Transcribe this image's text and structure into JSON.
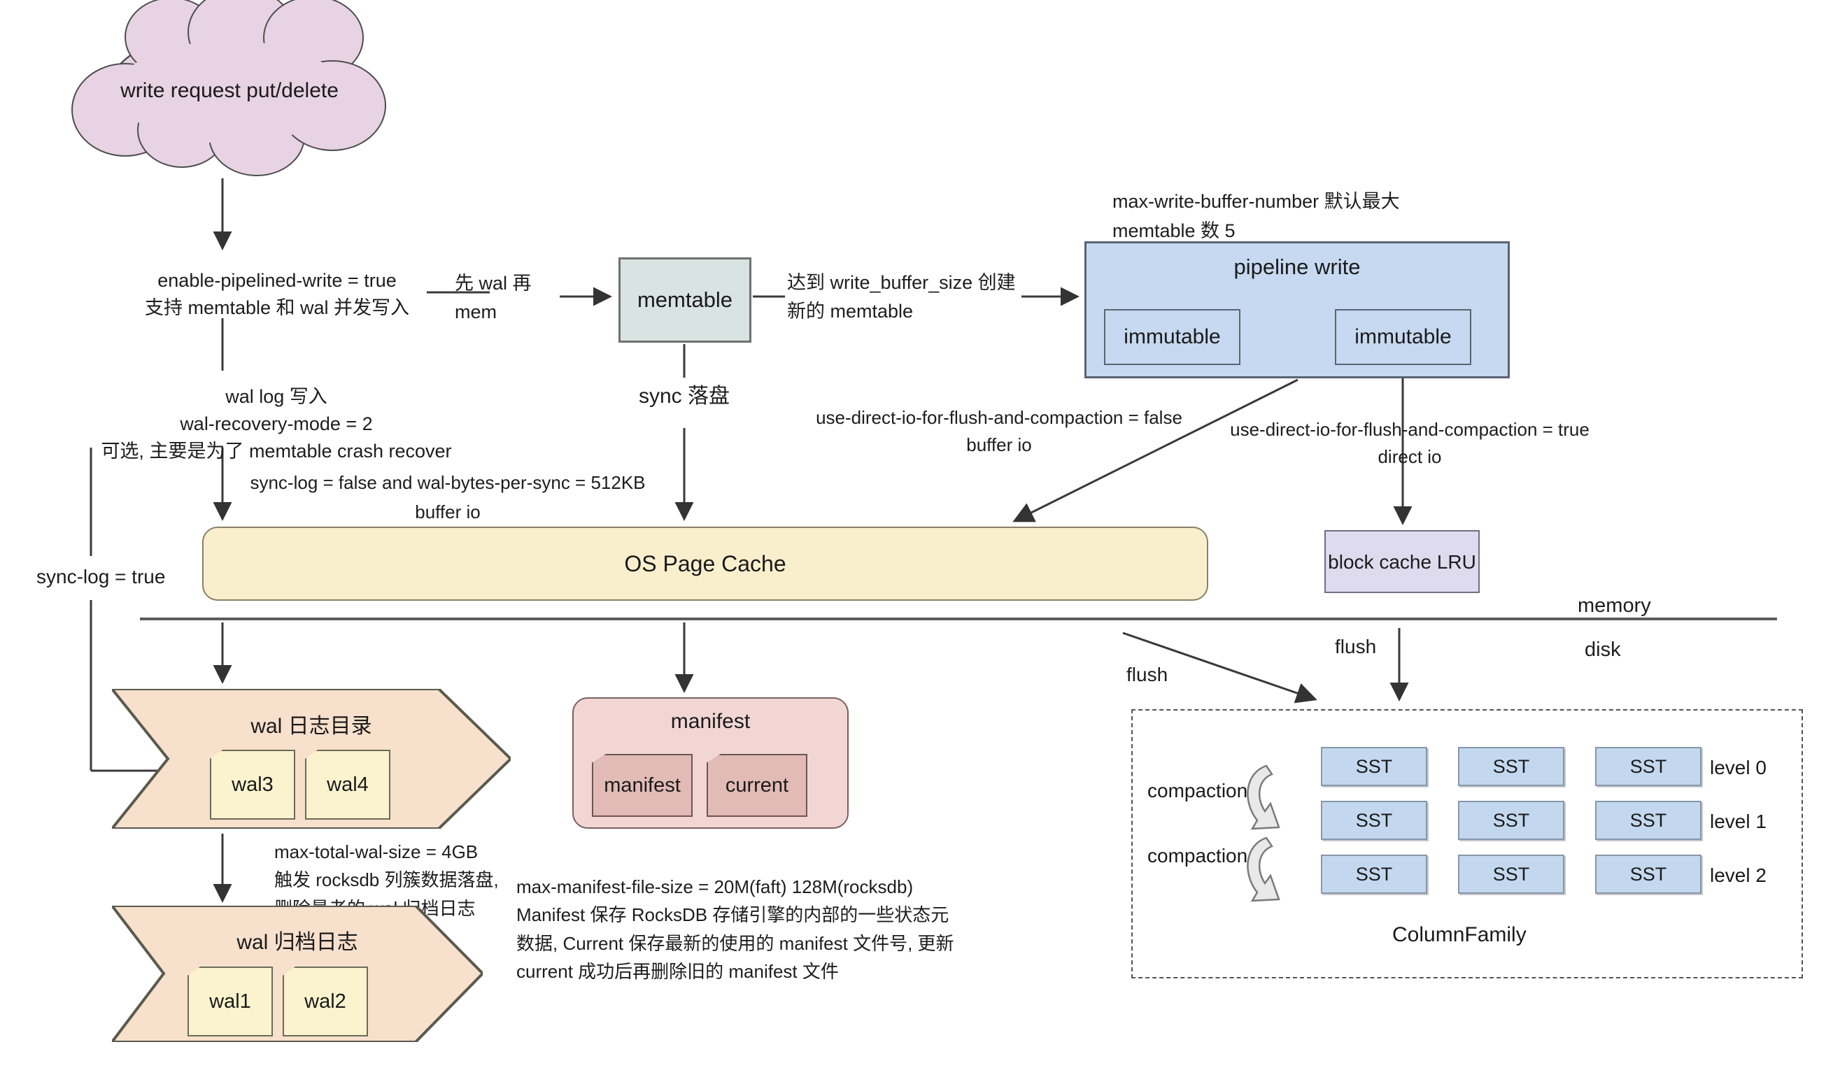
{
  "diagram": {
    "title_nodes": {
      "cloud": "write request\nput/delete",
      "memtable": "memtable",
      "pipeline_write": "pipeline write",
      "immutable_1": "immutable",
      "immutable_2": "immutable",
      "os_page_cache": "OS Page Cache",
      "block_cache": "block cache\nLRU",
      "wal_dir_title": "wal 日志目录",
      "wal_archive_title": "wal 归档日志",
      "manifest_title": "manifest",
      "column_family": "ColumnFamily"
    },
    "wal_dir_files": [
      "wal3",
      "wal4"
    ],
    "wal_archive_files": [
      "wal1",
      "wal2"
    ],
    "manifest_files": [
      "manifest",
      "current"
    ],
    "edge_labels": {
      "enable_pipelined": "enable-pipelined-write = true\n支持 memtable 和 wal 并发写入",
      "wal_log_write": "wal log 写入\nwal-recovery-mode = 2\n可选, 主要是为了 memtable crash recover",
      "wal_then_mem": "先 wal 再\nmem",
      "reach_buffer_size": "达到 write_buffer_size 创建\n新的 memtable",
      "sync_luopan": "sync 落盘",
      "max_write_buffer_number": "max-write-buffer-number 默认最大\nmemtable 数 5",
      "direct_io_false": "use-direct-io-for-flush-and-compaction = false\nbuffer io",
      "direct_io_true": "use-direct-io-for-flush-and-compaction = true\ndirect io",
      "sync_log_false": "sync-log = false and wal-bytes-per-sync = 512KB\nbuffer io",
      "sync_log_true": "sync-log = true",
      "memory": "memory",
      "disk": "disk",
      "flush_left": "flush",
      "flush_right": "flush",
      "compaction_1": "compaction",
      "compaction_2": "compaction",
      "max_total_wal_size": "max-total-wal-size = 4GB\n触发 rocksdb 列簇数据落盘,\n删除最老的 wal 归档日志",
      "manifest_desc": "max-manifest-file-size = 20M(faft) 128M(rocksdb)\nManifest 保存 RocksDB 存储引擎的内部的一些状态元\n数据, Current 保存最新的使用的 manifest 文件号, 更新\ncurrent 成功后再删除旧的 manifest 文件"
    },
    "sst_levels": [
      {
        "label": "level 0",
        "cells": [
          "SST",
          "SST",
          "SST"
        ]
      },
      {
        "label": "level 1",
        "cells": [
          "SST",
          "SST",
          "SST"
        ]
      },
      {
        "label": "level 2",
        "cells": [
          "SST",
          "SST",
          "SST"
        ]
      }
    ],
    "colors": {
      "cloud": "#e7d3e3",
      "memtable": "#d9e3e2",
      "pipeline": "#c6d9f1",
      "page_cache": "#faefcd",
      "block_cache": "#dedbee",
      "wal_chevron": "#f7e0cc",
      "wal_file": "#fbf3cd",
      "manifest": "#f2d6d4",
      "manifest_file": "#e2bbb6",
      "sst": "#c3d8ef",
      "stroke": "#4d4d4d"
    }
  }
}
